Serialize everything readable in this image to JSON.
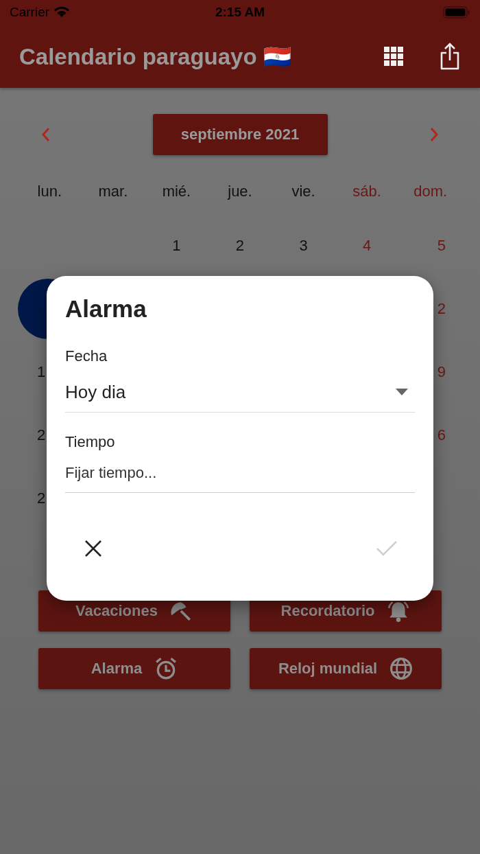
{
  "status_bar": {
    "carrier": "Carrier",
    "time": "2:15 AM"
  },
  "app_bar": {
    "title": "Calendario paraguayo 🇵🇾"
  },
  "calendar": {
    "month": "septiembre 2021",
    "weekdays": [
      {
        "text": "lun.",
        "color": "#111111"
      },
      {
        "text": "mar.",
        "color": "#111111"
      },
      {
        "text": "mié.",
        "color": "#111111"
      },
      {
        "text": "jue.",
        "color": "#111111"
      },
      {
        "text": "vie.",
        "color": "#111111"
      },
      {
        "text": "sáb.",
        "color": "#6b1712"
      },
      {
        "text": "dom.",
        "color": "#6b1712"
      }
    ],
    "first_week": [
      {
        "text": "1",
        "selected": false
      },
      {
        "text": "2",
        "selected": false
      },
      {
        "text": "3",
        "selected": false
      },
      {
        "text": "4",
        "selected": false
      },
      {
        "text": "5",
        "selected": false
      }
    ],
    "peeking_weeks": [
      {
        "left": {
          "selected": true
        },
        "right": {
          "text": "2",
          "selected": false
        }
      },
      {
        "left": {
          "text": "1",
          "selected": false
        },
        "right": {
          "text": "9",
          "selected": false
        }
      },
      {
        "left": {
          "text": "2",
          "selected": false
        },
        "right": {
          "text": "6",
          "selected": false
        }
      },
      {
        "left": {
          "text": "2",
          "selected": false
        }
      }
    ]
  },
  "actions": [
    {
      "label": "Vacaciones",
      "kind": "umbrella"
    },
    {
      "label": "Recordatorio",
      "kind": "bell"
    },
    {
      "label": "Alarma",
      "kind": "alarm"
    },
    {
      "label": "Reloj mundial",
      "kind": "globe"
    }
  ],
  "dialog": {
    "title": "Alarma",
    "date_label": "Fecha",
    "date_value": "Hoy dia",
    "time_label": "Tiempo",
    "time_placeholder": "Fijar tiempo...",
    "confirm_disabled": true
  }
}
